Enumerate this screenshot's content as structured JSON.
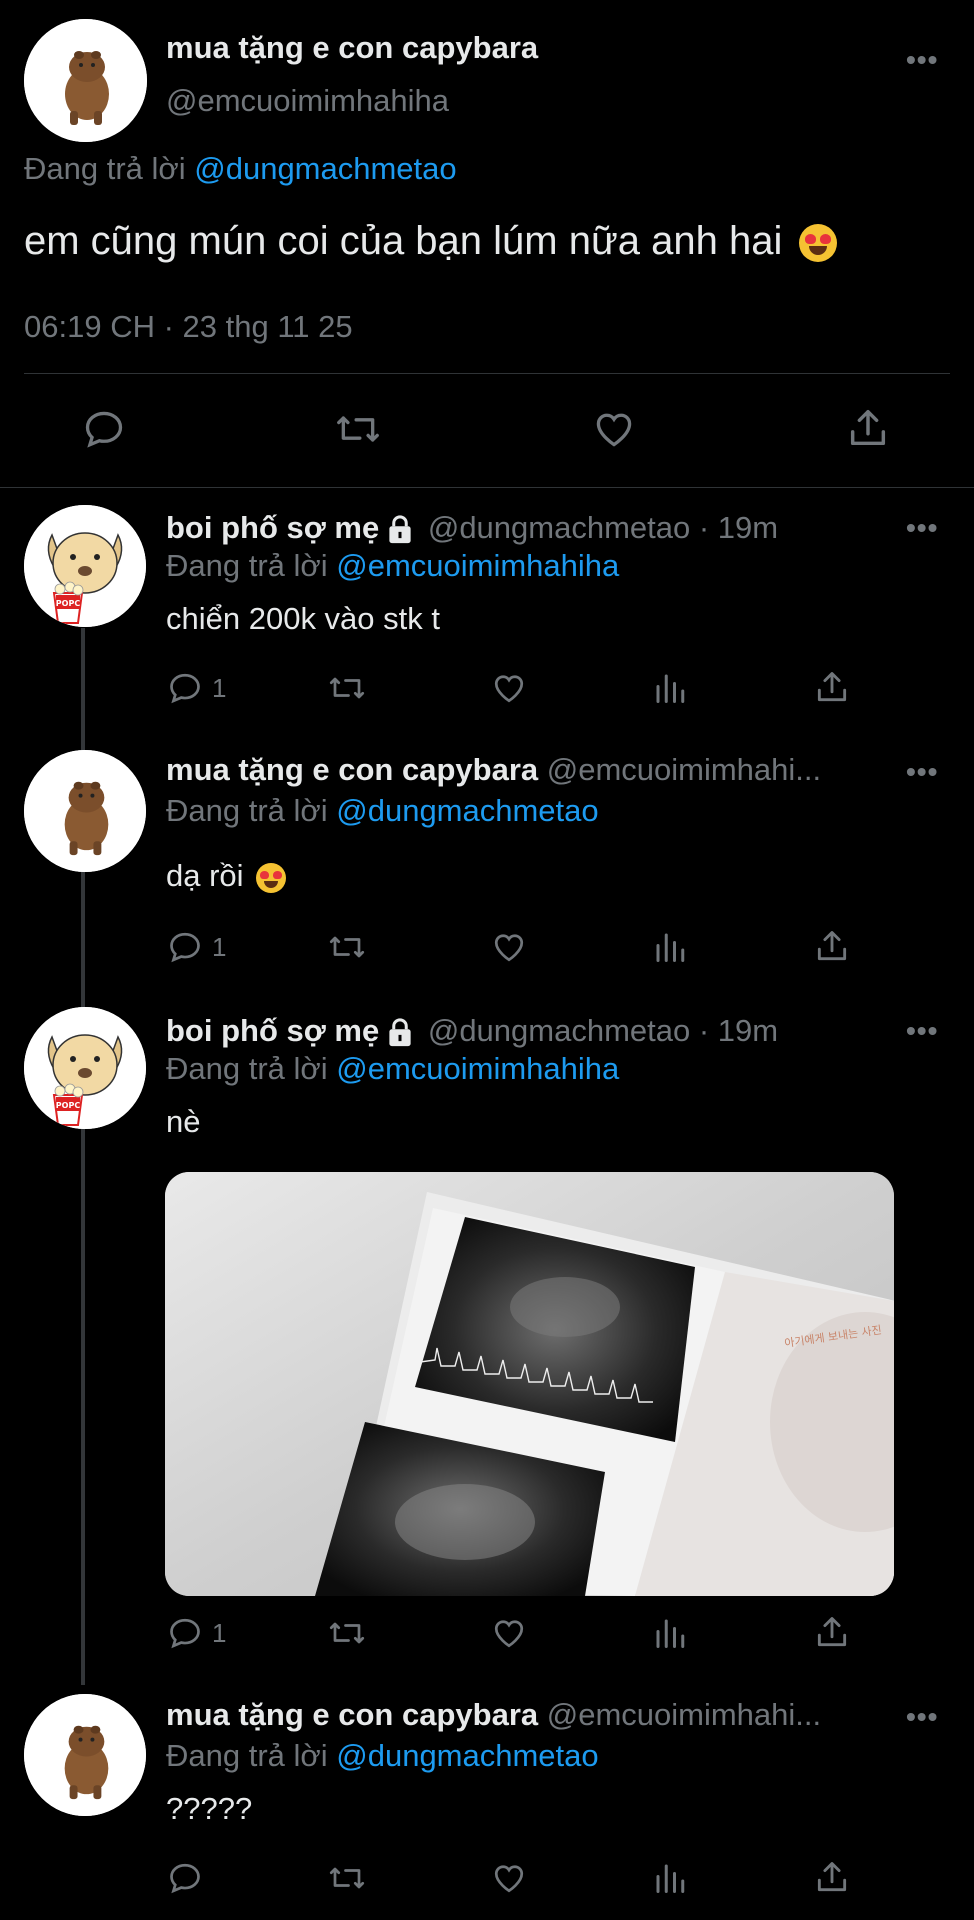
{
  "main_tweet": {
    "author_name": "mua tặng e con capybara",
    "author_handle": "@emcuoimimhahiha",
    "reply_prefix": "Đang trả lời",
    "reply_to": "@dungmachmetao",
    "text": "em cũng mún coi của bạn lúm nữa anh hai",
    "timestamp": "06:19 CH · 23 thg 11 25",
    "more_label": "•••"
  },
  "replies": [
    {
      "name": "boi phố sợ mẹ",
      "handle": "@dungmachmetao",
      "time": "· 19m",
      "reply_prefix": "Đang trả lời",
      "reply_to": "@emcuoimimhahiha",
      "text": "chiển 200k vào stk t",
      "reply_count": "1",
      "more_label": "•••"
    },
    {
      "name": "mua tặng e con capybara",
      "handle": "@emcuoimimhahi...",
      "reply_prefix": "Đang trả lời",
      "reply_to": "@dungmachmetao",
      "text": "dạ rồi",
      "reply_count": "1",
      "more_label": "•••"
    },
    {
      "name": "boi phố sợ mẹ",
      "handle": "@dungmachmetao",
      "time": "· 19m",
      "reply_prefix": "Đang trả lời",
      "reply_to": "@emcuoimimhahiha",
      "text": "nè",
      "reply_count": "1",
      "more_label": "•••",
      "photo_caption": "아기에게 보내는 사진"
    },
    {
      "name": "mua tặng e con capybara",
      "handle": "@emcuoimimhahi...",
      "reply_prefix": "Đang trả lời",
      "reply_to": "@dungmachmetao",
      "text": "?????",
      "more_label": "•••"
    }
  ],
  "avatar_popcorn_label": "POPC",
  "colors": {
    "background": "#000000",
    "text": "#e7e9ea",
    "muted": "#71767b",
    "link": "#1d9bf0",
    "divider": "#2f3336"
  },
  "icons": [
    "reply-icon",
    "retweet-icon",
    "like-icon",
    "views-icon",
    "share-icon",
    "lock-icon",
    "heart-eyes-emoji"
  ]
}
